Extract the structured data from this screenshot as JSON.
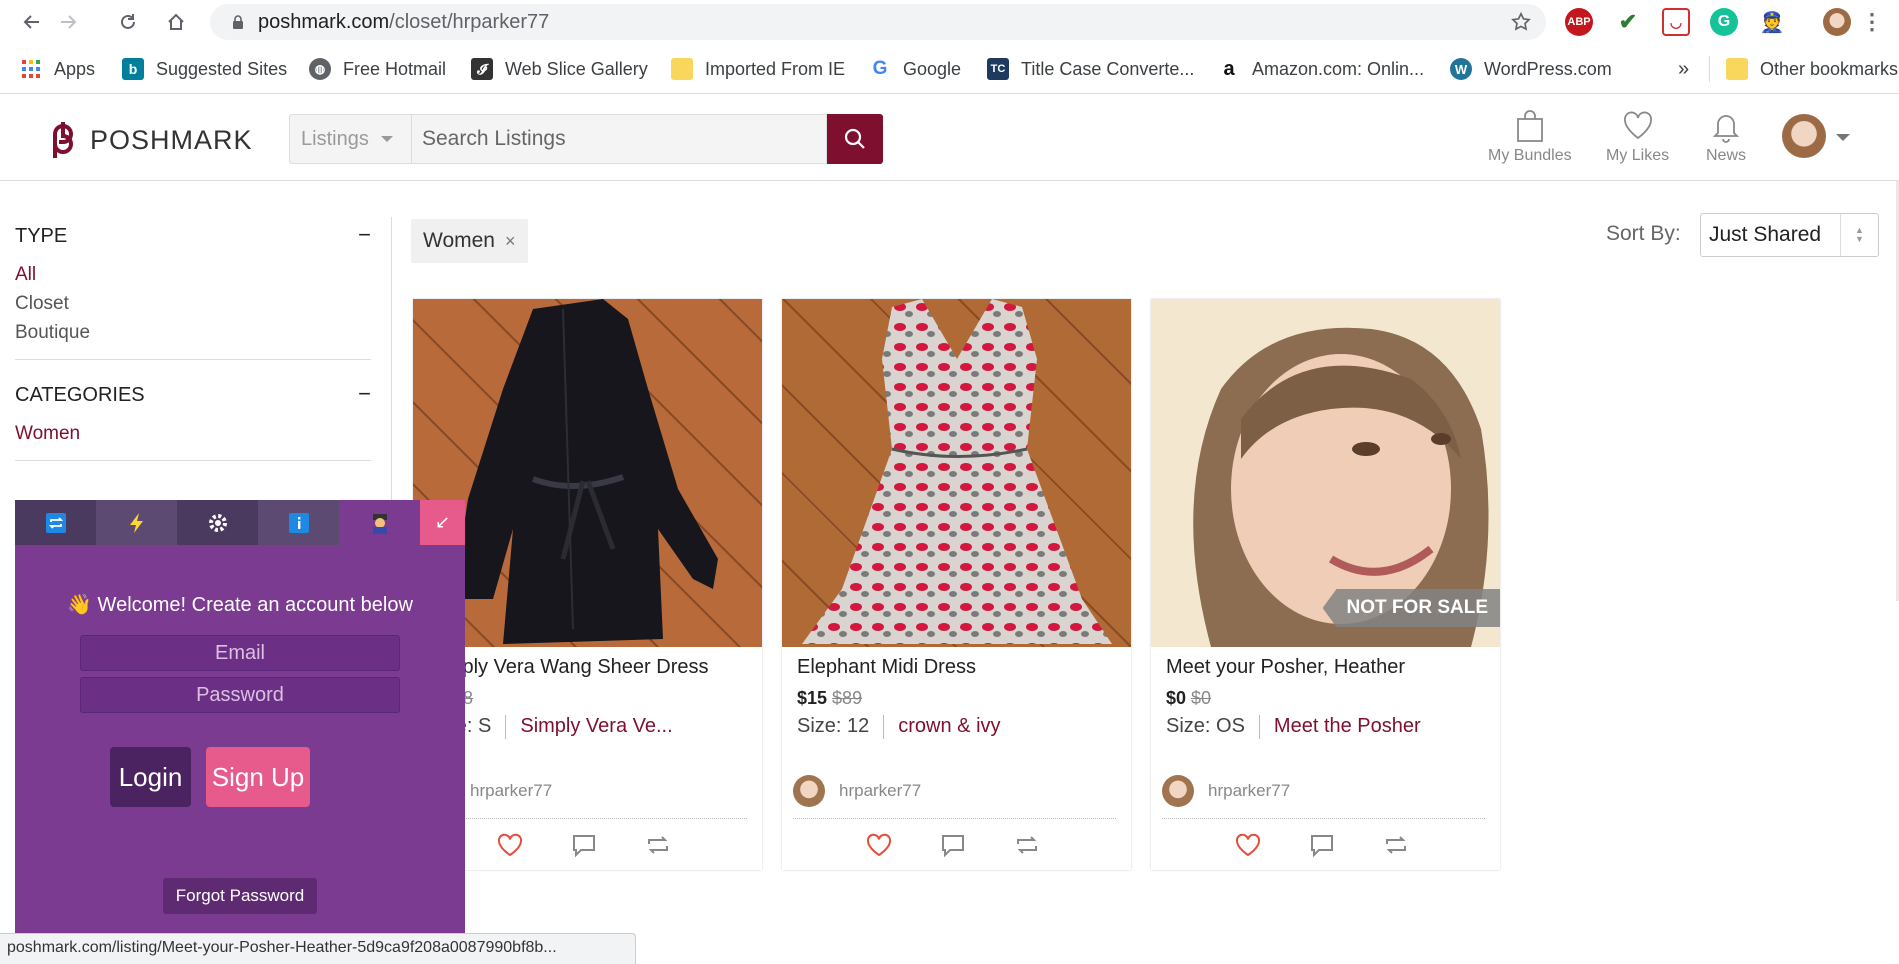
{
  "browser": {
    "url_host": "poshmark.com",
    "url_path": "/closet/hrparker77",
    "bookmarks": [
      {
        "label": "Apps",
        "icon": "apps-grid-icon"
      },
      {
        "label": "Suggested Sites",
        "icon": "bing-icon"
      },
      {
        "label": "Free Hotmail",
        "icon": "globe-icon"
      },
      {
        "label": "Web Slice Gallery",
        "icon": "web-slice-icon"
      },
      {
        "label": "Imported From IE",
        "icon": "folder-icon"
      },
      {
        "label": "Google",
        "icon": "google-icon"
      },
      {
        "label": "Title Case Converte...",
        "icon": "tc-icon"
      },
      {
        "label": "Amazon.com: Onlin...",
        "icon": "amazon-icon"
      },
      {
        "label": "WordPress.com",
        "icon": "wordpress-icon"
      }
    ],
    "overflow_label": "»",
    "other_bookmarks": "Other bookmarks",
    "status_url": "poshmark.com/listing/Meet-your-Posher-Heather-5d9ca9f208a0087990bf8b..."
  },
  "header": {
    "logo_text": "POSHMARK",
    "category_select": "Listings",
    "search_placeholder": "Search Listings",
    "nav": [
      {
        "label": "My Bundles",
        "icon": "bag-icon"
      },
      {
        "label": "My Likes",
        "icon": "heart-icon"
      },
      {
        "label": "News",
        "icon": "bell-icon"
      }
    ]
  },
  "sidebar": {
    "type_title": "TYPE",
    "type_items": [
      "All",
      "Closet",
      "Boutique"
    ],
    "categories_title": "CATEGORIES",
    "category_items": [
      "Women"
    ],
    "collapse_symbol": "−"
  },
  "filters": {
    "chip_label": "Women",
    "chip_close": "×",
    "sort_label": "Sort By:",
    "sort_value": "Just Shared"
  },
  "listings": [
    {
      "title": "Simply Vera Wang Sheer Dress",
      "price": "$",
      "original_price": "$68",
      "size": "Size: S",
      "brand": "Simply Vera Ve...",
      "seller": "hrparker77"
    },
    {
      "title": "Elephant Midi Dress",
      "price": "$15",
      "original_price": "$89",
      "size": "Size: 12",
      "brand": "crown & ivy",
      "seller": "hrparker77"
    },
    {
      "title": "Meet your Posher, Heather",
      "price": "$0",
      "original_price": "$0",
      "size": "Size: OS",
      "brand": "Meet the Posher",
      "seller": "hrparker77",
      "badge": "NOT FOR SALE"
    }
  ],
  "extension": {
    "tabs": [
      "share-icon",
      "lightning-icon",
      "gear-icon",
      "info-icon",
      "user-icon"
    ],
    "close_symbol": "↙",
    "welcome": "👋 Welcome! Create an account below",
    "email_placeholder": "Email",
    "password_placeholder": "Password",
    "login_label": "Login",
    "signup_label": "Sign Up",
    "forgot_label": "Forgot Password"
  },
  "colors": {
    "brand": "#7f0f2e",
    "popup_bg": "#7b3b90",
    "signup": "#e75a8c"
  }
}
